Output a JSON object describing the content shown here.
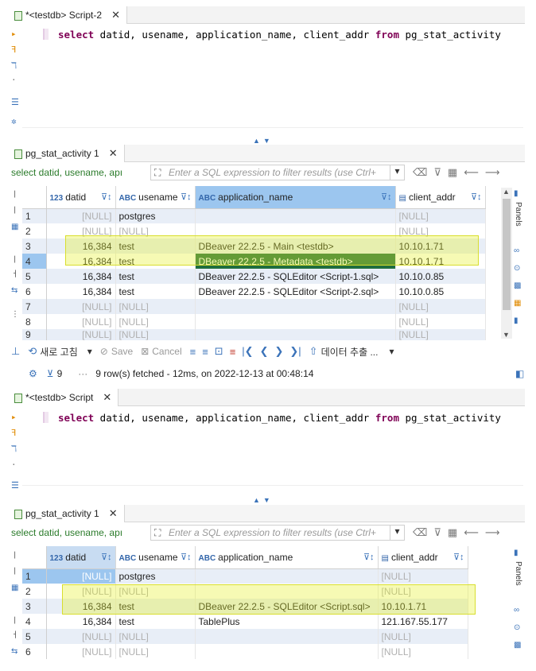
{
  "editor1": {
    "tab_title": "*<testdb> Script-2",
    "sql_keyword_select": "select",
    "sql_columns": " datid, usename, application_name, client_addr ",
    "sql_keyword_from": "from",
    "sql_table": " pg_stat_activity"
  },
  "results1": {
    "tab_title": "pg_stat_activity 1",
    "filter_query": "select datid, usename, apı",
    "filter_placeholder": "Enter a SQL expression to filter results (use Ctrl+",
    "columns": [
      {
        "type": "123",
        "name": "datid"
      },
      {
        "type": "ABC",
        "name": "usename"
      },
      {
        "type": "ABC",
        "name": "application_name"
      },
      {
        "type": "",
        "name": "client_addr"
      }
    ],
    "rows": [
      {
        "n": "1",
        "datid": "[NULL]",
        "usename": "postgres",
        "app": "",
        "addr": "[NULL]"
      },
      {
        "n": "2",
        "datid": "[NULL]",
        "usename": "[NULL]",
        "app": "",
        "addr": "[NULL]"
      },
      {
        "n": "3",
        "datid": "16,384",
        "usename": "test",
        "app": "DBeaver 22.2.5 - Main <testdb>",
        "addr": "10.10.1.71"
      },
      {
        "n": "4",
        "datid": "16,384",
        "usename": "test",
        "app": "DBeaver 22.2.5 - Metadata <testdb>",
        "addr": "10.10.1.71"
      },
      {
        "n": "5",
        "datid": "16,384",
        "usename": "test",
        "app": "DBeaver 22.2.5 - SQLEditor <Script-1.sql>",
        "addr": "10.10.0.85"
      },
      {
        "n": "6",
        "datid": "16,384",
        "usename": "test",
        "app": "DBeaver 22.2.5 - SQLEditor <Script-2.sql>",
        "addr": "10.10.0.85"
      },
      {
        "n": "7",
        "datid": "[NULL]",
        "usename": "[NULL]",
        "app": "",
        "addr": "[NULL]"
      },
      {
        "n": "8",
        "datid": "[NULL]",
        "usename": "[NULL]",
        "app": "",
        "addr": "[NULL]"
      },
      {
        "n": "9",
        "datid": "[NULL]",
        "usename": "[NULL]",
        "app": "",
        "addr": "[NULL]"
      }
    ],
    "toolbar": {
      "refresh": "새로 고침",
      "save": "Save",
      "cancel": "Cancel",
      "export": "데이터 추출 ..."
    },
    "status": {
      "count": "9",
      "message": "9 row(s) fetched - 12ms, on 2022-12-13 at 00:48:14"
    },
    "side_label": "Panels"
  },
  "editor2": {
    "tab_title": "*<testdb> Script",
    "sql_keyword_select": "select",
    "sql_columns": " datid, usename, application_name, client_addr ",
    "sql_keyword_from": "from",
    "sql_table": " pg_stat_activity"
  },
  "results2": {
    "tab_title": "pg_stat_activity 1",
    "filter_query": "select datid, usename, apı",
    "filter_placeholder": "Enter a SQL expression to filter results (use Ctrl+",
    "columns": [
      {
        "type": "123",
        "name": "datid"
      },
      {
        "type": "ABC",
        "name": "usename"
      },
      {
        "type": "ABC",
        "name": "application_name"
      },
      {
        "type": "",
        "name": "client_addr"
      }
    ],
    "rows": [
      {
        "n": "1",
        "datid": "[NULL]",
        "usename": "postgres",
        "app": "",
        "addr": "[NULL]"
      },
      {
        "n": "2",
        "datid": "[NULL]",
        "usename": "[NULL]",
        "app": "",
        "addr": "[NULL]"
      },
      {
        "n": "3",
        "datid": "16,384",
        "usename": "test",
        "app": "DBeaver 22.2.5 - SQLEditor <Script.sql>",
        "addr": "10.10.1.71"
      },
      {
        "n": "4",
        "datid": "16,384",
        "usename": "test",
        "app": "TablePlus",
        "addr": "121.167.55.177"
      },
      {
        "n": "5",
        "datid": "[NULL]",
        "usename": "[NULL]",
        "app": "",
        "addr": "[NULL]"
      },
      {
        "n": "6",
        "datid": "[NULL]",
        "usename": "[NULL]",
        "app": "",
        "addr": "[NULL]"
      }
    ],
    "side_label": "Panels"
  }
}
